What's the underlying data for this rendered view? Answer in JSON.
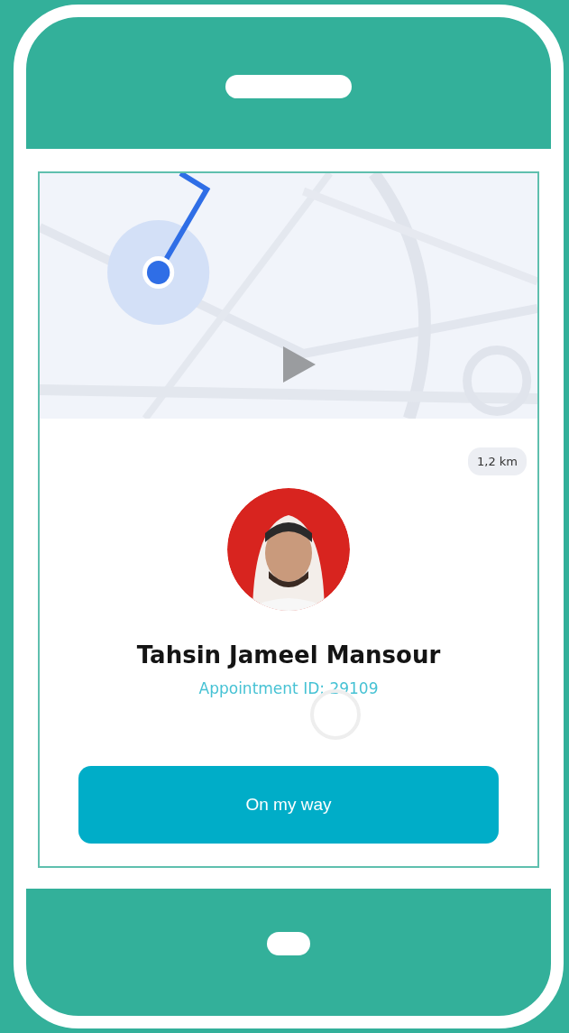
{
  "trip": {
    "distance": "1,2 km"
  },
  "client": {
    "name": "Tahsin Jameel Mansour",
    "appointment": "Appointment ID: 29109"
  },
  "action_button": {
    "label": "On my way"
  }
}
